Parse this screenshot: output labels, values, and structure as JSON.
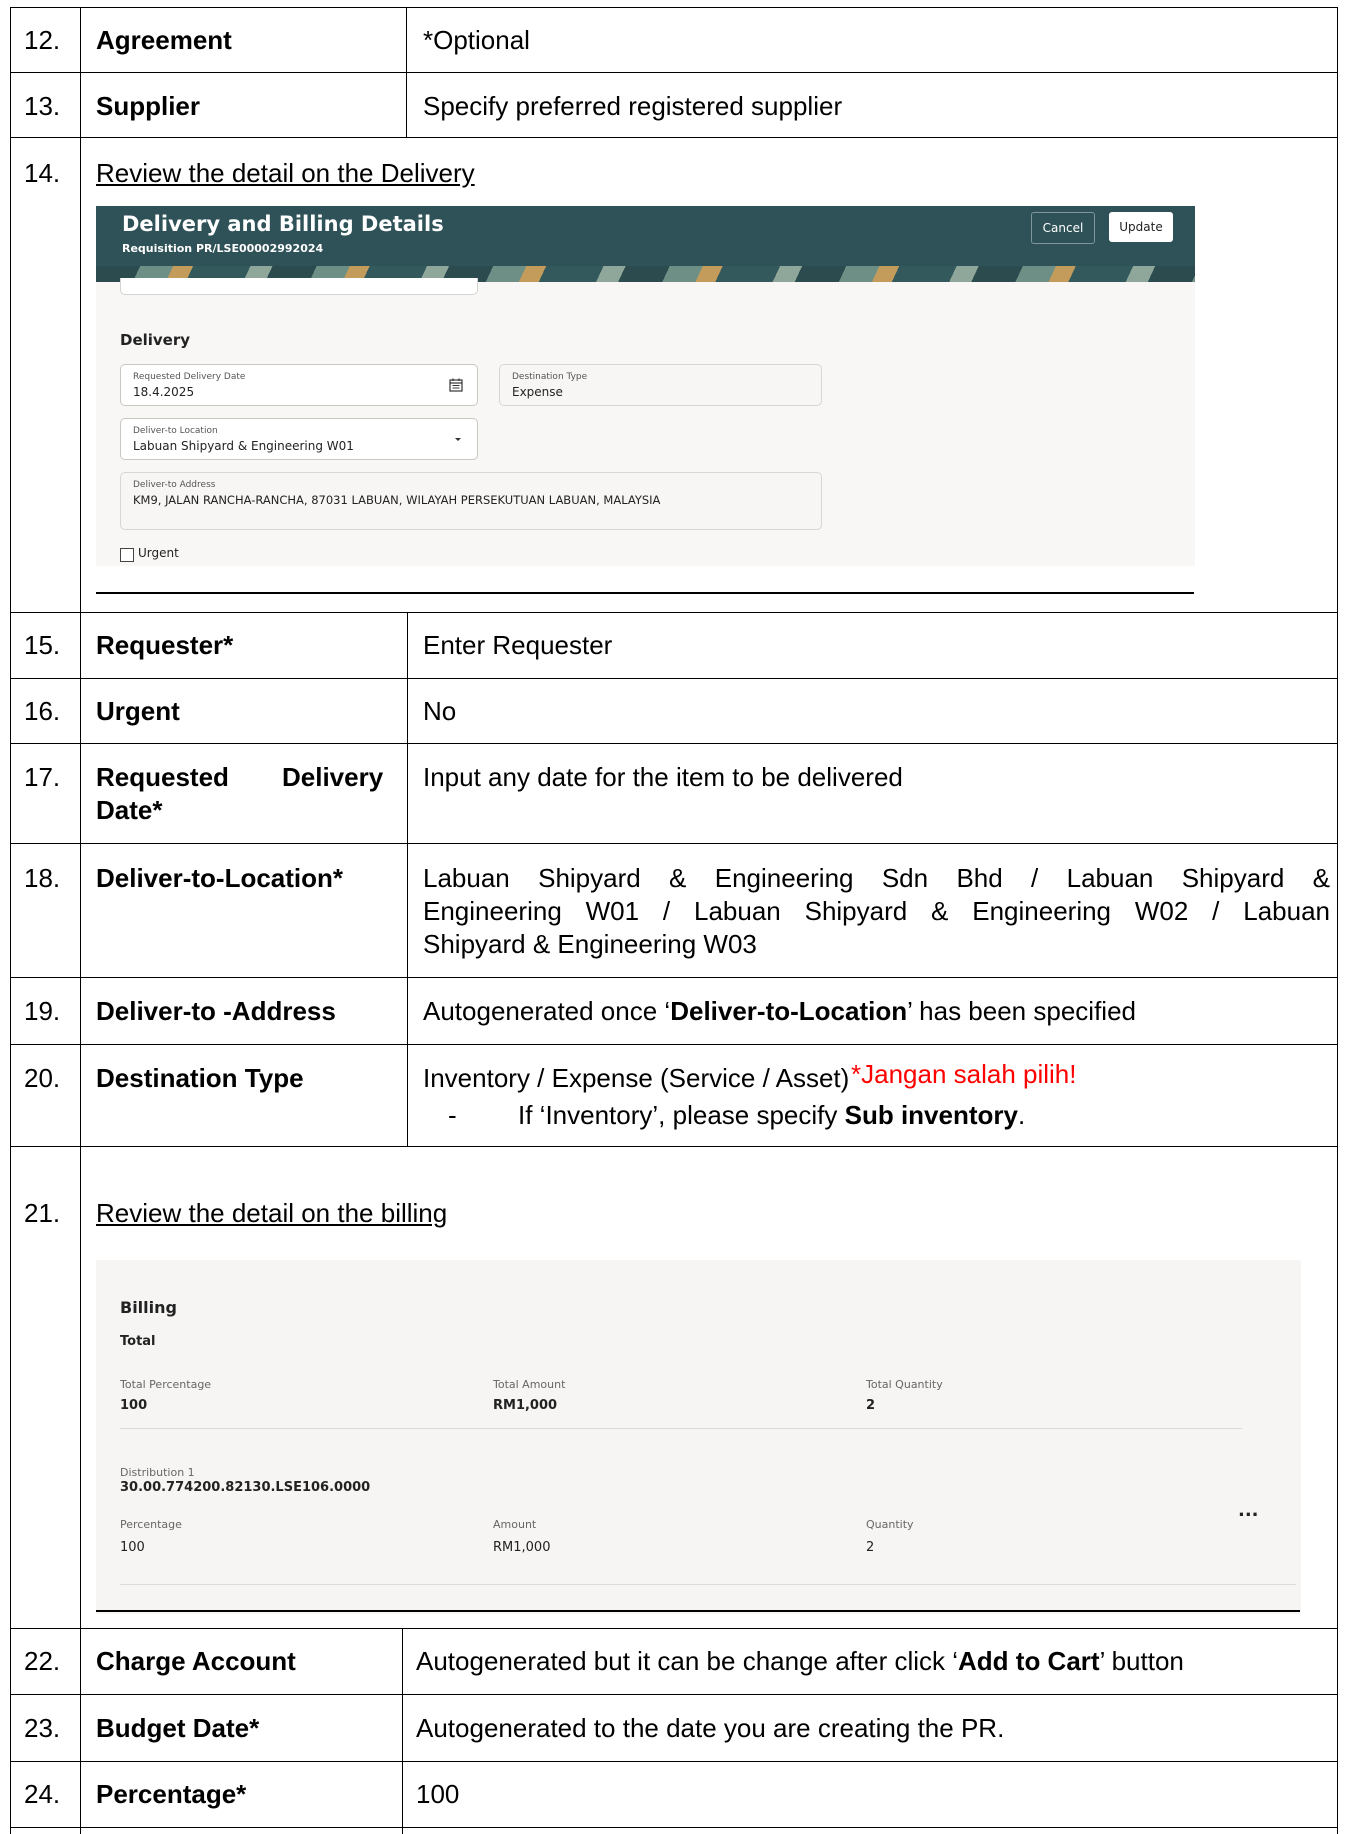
{
  "rows_top": [
    {
      "num": "12.",
      "label": "Agreement",
      "value": "*Optional"
    },
    {
      "num": "13.",
      "label": "Supplier",
      "value": "Specify preferred registered supplier"
    }
  ],
  "row14": {
    "num": "14.",
    "text": "Review the detail on the Delivery"
  },
  "delivery_screen": {
    "title": "Delivery and Billing Details",
    "subtitle": "Requisition PR/LSE00002992024",
    "cancel_label": "Cancel",
    "update_label": "Update",
    "section_title": "Delivery",
    "requested_date": {
      "label": "Requested Delivery Date",
      "value": "18.4.2025"
    },
    "destination_type": {
      "label": "Destination Type",
      "value": "Expense"
    },
    "deliver_location": {
      "label": "Deliver-to Location",
      "value": "Labuan Shipyard & Engineering W01"
    },
    "deliver_address": {
      "label": "Deliver-to Address",
      "value": "KM9, JALAN RANCHA-RANCHA, 87031 LABUAN, WILAYAH PERSEKUTUAN LABUAN, MALAYSIA"
    },
    "urgent_label": "Urgent"
  },
  "rows_mid": [
    {
      "num": "15.",
      "label": "Requester*",
      "value": "Enter Requester"
    },
    {
      "num": "16.",
      "label": "Urgent",
      "value": "No"
    },
    {
      "num": "17.",
      "label_a": "Requested",
      "label_b": "Delivery",
      "label_c": "Date*",
      "value": "Input any date for the item to be delivered"
    },
    {
      "num": "18.",
      "label": "Deliver-to-Location*",
      "line1": "Labuan Shipyard & Engineering Sdn Bhd / Labuan Shipyard &",
      "line2": "Engineering W01 / Labuan Shipyard & Engineering W02 / Labuan",
      "line3": "Shipyard & Engineering W03"
    },
    {
      "num": "19.",
      "label": "Deliver-to -Address",
      "pre": "Autogenerated once ‘",
      "bold": "Deliver-to-Location",
      "post": "’ has been specified"
    },
    {
      "num": "20.",
      "label": "Destination Type",
      "value": "Inventory / Expense (Service / Asset)",
      "warning": "*Jangan salah pilih!",
      "bullet_dash": "-",
      "bullet_pre": "If ‘Inventory’, please specify ",
      "bullet_bold": "Sub inventory",
      "bullet_post": "."
    }
  ],
  "row21": {
    "num": "21.",
    "text": "Review the detail on the billing"
  },
  "billing_screen": {
    "title": "Billing",
    "total_heading": "Total",
    "total_percentage_label": "Total Percentage",
    "total_percentage": "100",
    "total_amount_label": "Total Amount",
    "total_amount": "RM1,000",
    "total_quantity_label": "Total Quantity",
    "total_quantity": "2",
    "distribution_label": "Distribution 1",
    "distribution_account": "30.00.774200.82130.LSE106.0000",
    "percentage_label": "Percentage",
    "percentage": "100",
    "amount_label": "Amount",
    "amount": "RM1,000",
    "quantity_label": "Quantity",
    "quantity": "2",
    "more_label": "..."
  },
  "rows_bottom": [
    {
      "num": "22.",
      "label": "Charge Account",
      "pre": "Autogenerated but it can be change after click ‘",
      "bold": "Add to Cart",
      "post": "’ button"
    },
    {
      "num": "23.",
      "label": "Budget Date*",
      "value": "Autogenerated to the date you are creating the PR."
    },
    {
      "num": "24.",
      "label": "Percentage*",
      "value": "100"
    }
  ]
}
